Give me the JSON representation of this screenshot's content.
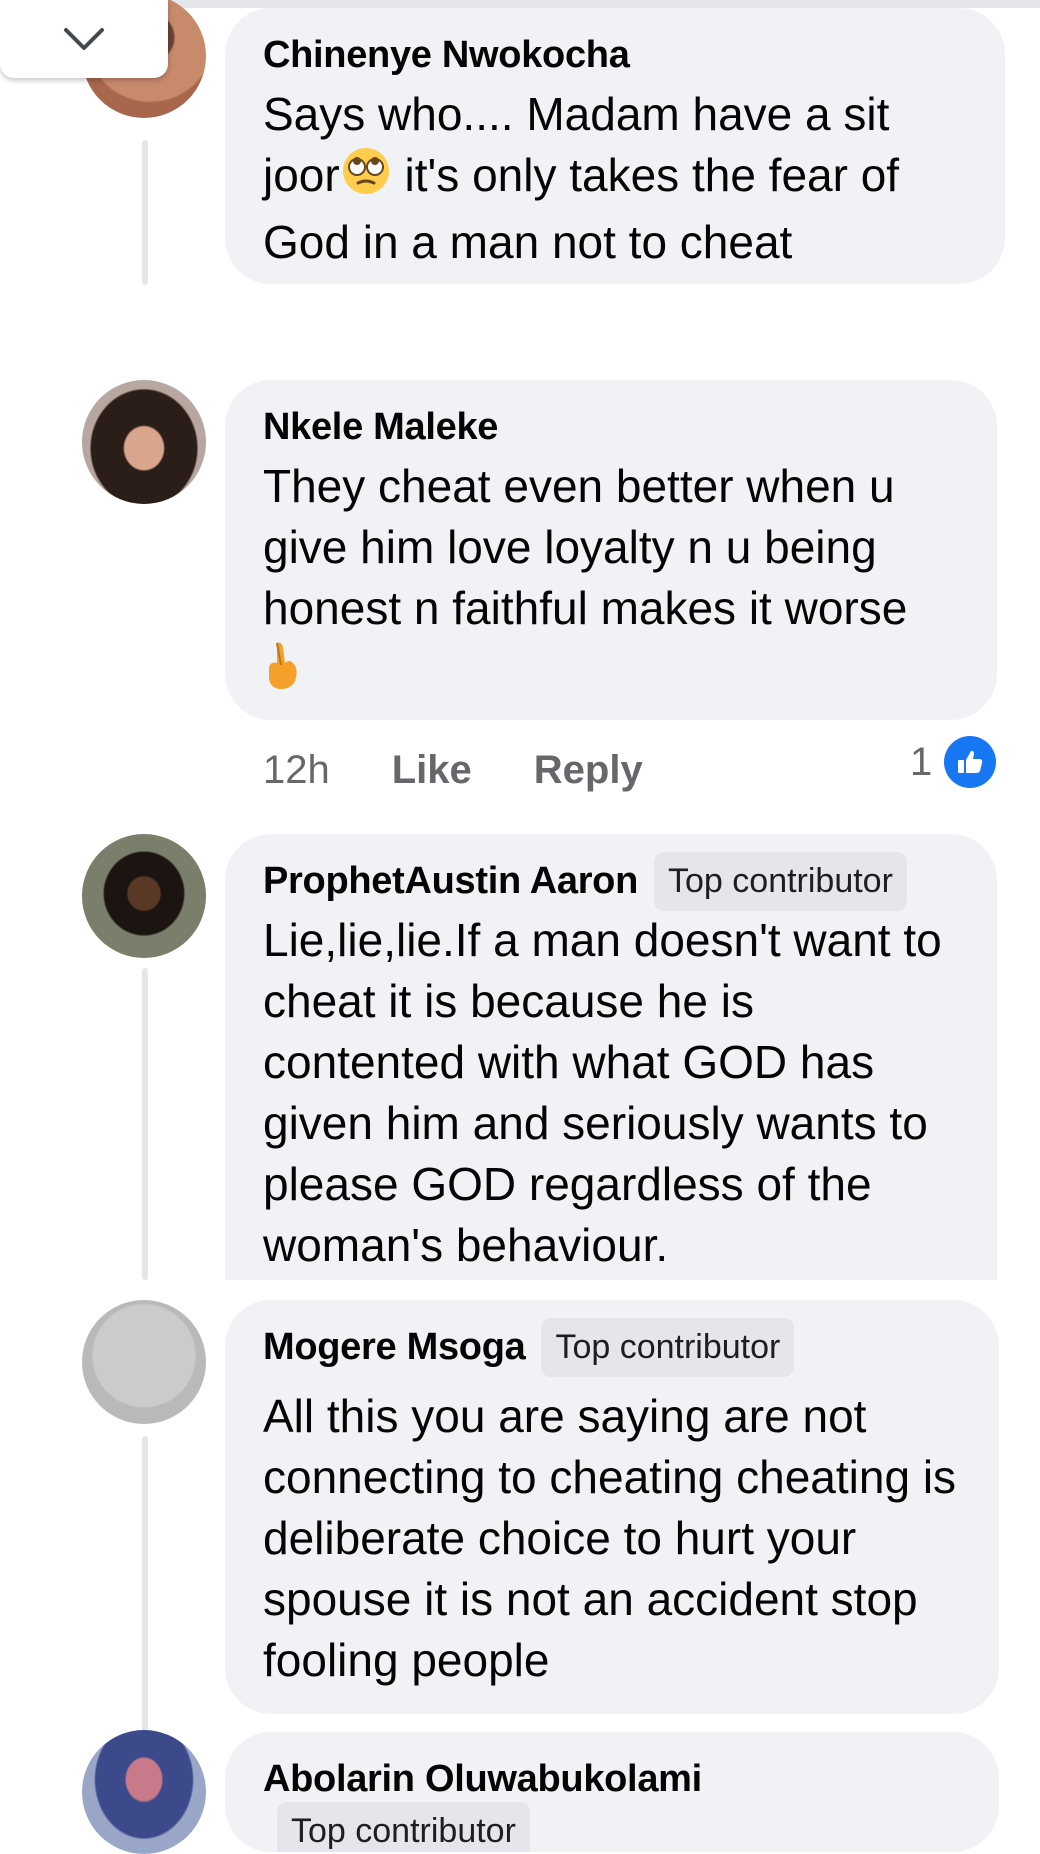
{
  "comments": [
    {
      "author": "Chinenye Nwokocha",
      "text_parts": [
        "Says who.... Madam have a sit joor",
        "it's only takes the fear of God in a man not to cheat"
      ],
      "emoji_icon": "eye-roll-emoji"
    },
    {
      "author": "Nkele Maleke",
      "text": "They  cheat even better when u give him love loyalty n u being honest n faithful makes it worse",
      "emoji_icon": "crossed-fingers-emoji",
      "meta": {
        "time": "12h",
        "like": "Like",
        "reply": "Reply",
        "reaction_count": "1",
        "reaction_icon": "like-icon"
      }
    },
    {
      "author": "ProphetAustin Aaron",
      "badge": "Top contributor",
      "text": "Lie,lie,lie.If a man doesn't want to cheat it is because he is contented with  what GOD has given him and seriously wants to please GOD regardless of the woman's behaviour."
    },
    {
      "author": "Mogere Msoga",
      "badge": "Top contributor",
      "text": "All this you are saying are not connecting to cheating cheating is deliberate choice to hurt your spouse it is not an accident stop fooling people"
    },
    {
      "author": "Abolarin Oluwabukolami",
      "badge": "Top contributor"
    }
  ],
  "collapse_icon": "chevron-down-icon",
  "colors": {
    "bubble": "#f0f2f5",
    "thread": "#e4e6eb",
    "like_blue": "#1877f2",
    "meta_gray": "#65676b"
  }
}
